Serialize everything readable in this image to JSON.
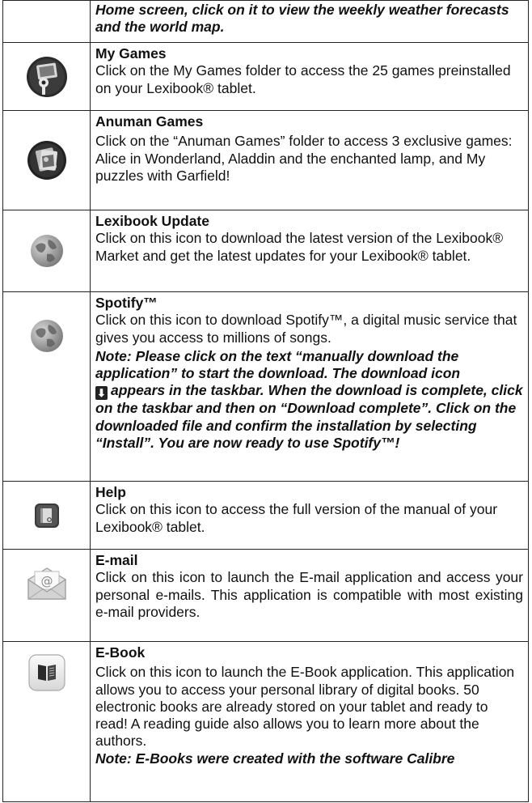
{
  "intro": {
    "text": "Home screen, click on it to view the weekly weather forecasts and the world map."
  },
  "rows": [
    {
      "icon": "games-folder-icon",
      "title": "My Games",
      "desc": "Click on the My Games folder to access the 25 games preinstalled on your Lexibook® tablet."
    },
    {
      "icon": "anuman-games-icon",
      "title": "Anuman Games",
      "desc": "Click on the “Anuman Games” folder to access 3 exclusive games: Alice in Wonderland, Aladdin and the enchanted lamp, and My puzzles with Garfield!"
    },
    {
      "icon": "globe-icon",
      "title": "Lexibook Update",
      "desc": "Click on this icon to download the latest version of the Lexibook® Market and get the latest updates for your Lexibook® tablet."
    },
    {
      "icon": "globe-icon",
      "title": "Spotify™",
      "desc": "Click on this icon to download Spotify™, a digital music service that gives you access to millions of songs.",
      "note_a": "Note: Please click on the text “manually download the application” to start the download. The download icon",
      "note_b": "appears in the taskbar. When the download is complete, click on the taskbar and then on “Download complete”. Click on the downloaded file and confirm the installation by selecting “Install”. You are now ready to use Spotify™!"
    },
    {
      "icon": "help-manual-icon",
      "title": "Help",
      "desc": "Click on this icon to access the full version of the manual of your Lexibook® tablet."
    },
    {
      "icon": "email-envelope-icon",
      "title": "E-mail",
      "desc": "Click on this icon to launch the E-mail application and access your personal e-mails. This application is compatible with most existing e-mail providers."
    },
    {
      "icon": "ebook-icon",
      "title": "E-Book",
      "desc": "Click on this icon to launch the E-Book application. This application allows you to access your personal library of digital books. 50 electronic books are already stored on your tablet and ready to read! A reading guide also allows you to learn more about the authors.",
      "note": "Note: E-Books were created with the software Calibre"
    }
  ]
}
